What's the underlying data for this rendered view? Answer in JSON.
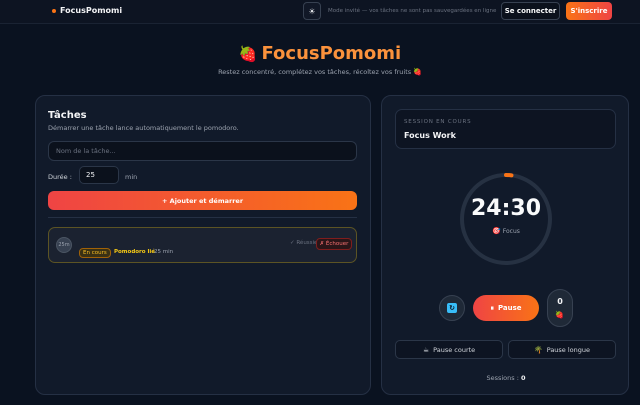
{
  "topbar": {
    "brand": "FocusPomomi",
    "theme_icon": "sun-icon",
    "guest_note": "Mode invité — vos tâches ne sont pas sauvegardées en ligne",
    "login_label": "Se connecter",
    "signup_label": "S'inscrire"
  },
  "hero": {
    "title": "FocusPomomi",
    "subtitle": "Restez concentré, complétez vos tâches, récoltez vos fruits",
    "fruit_icon": "🍓"
  },
  "tasks_panel": {
    "title": "Tâches",
    "subtitle": "Démarrer une tâche lance automatiquement le pomodoro.",
    "name_placeholder": "Nom de la tâche...",
    "duration_label": "Durée :",
    "duration_value": "25",
    "duration_unit": "min",
    "add_label": "+ Ajouter et démarrer",
    "tasks": [
      {
        "avatar": "25m",
        "status": "En cours",
        "name": "Pomodoro lié",
        "duration": "25 min",
        "done_label": "✓ Réussie",
        "fail_label": "✗ Échouer"
      }
    ]
  },
  "session_panel": {
    "label": "SESSION EN COURS",
    "value": "Focus Work",
    "timer": "24:30",
    "mode": "Focus",
    "mode_icon": "🎯",
    "progress": 0.02,
    "reset_icon": "reset-icon",
    "pause_label": "Pause",
    "pause_icon": "⏸",
    "fruit_count": "0",
    "fruit_icon": "🍓",
    "short_break_label": "Pause courte",
    "short_break_icon": "☕",
    "long_break_label": "Pause longue",
    "long_break_icon": "🌴",
    "sessions_label": "Sessions :",
    "sessions_value": "0"
  },
  "colors": {
    "accent": "#f97316",
    "accent_red": "#ef4444",
    "background": "#0a1220",
    "panel": "#111a2a"
  }
}
